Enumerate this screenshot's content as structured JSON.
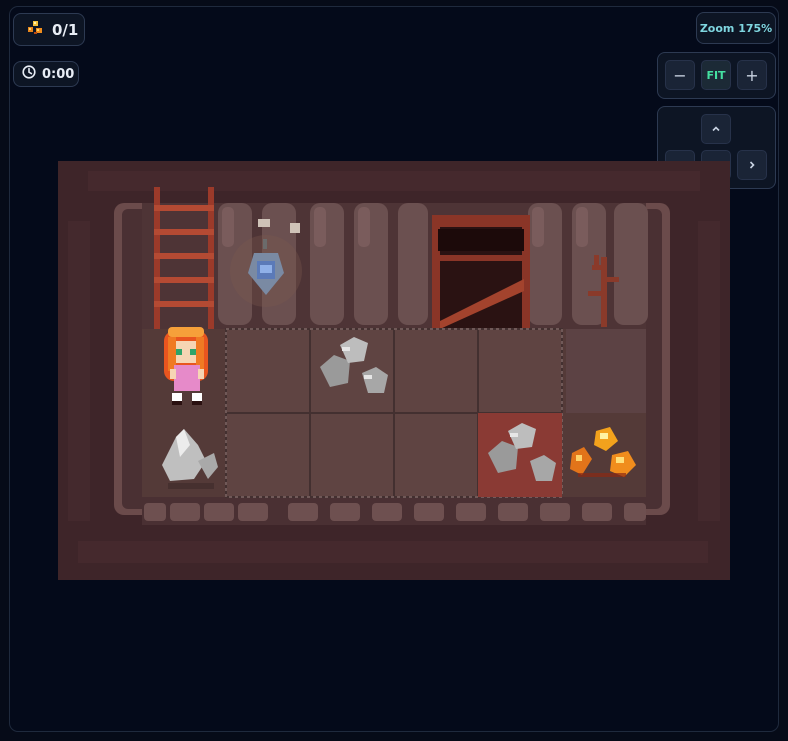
{
  "hud": {
    "ore_icon": "gold-ore-icon",
    "ore_counter": "0/1",
    "timer_icon": "clock-icon",
    "timer": "0:00",
    "zoom_label": "Zoom 175%"
  },
  "controls": {
    "zoom_out": "−",
    "fit": "FIT",
    "zoom_in": "+",
    "pan_up_icon": "chevron-up-icon",
    "pan_left_icon": "chevron-left-icon",
    "pan_down_icon": "chevron-down-icon",
    "pan_right_icon": "chevron-right-icon"
  },
  "scene": {
    "objects": [
      "ladder",
      "lantern",
      "mine-door",
      "dead-root",
      "player-miner",
      "stone-rocks",
      "crystal-rocks",
      "gold-ore"
    ],
    "colors": {
      "cave_bg": "#3e2529",
      "wall": "#5c4244",
      "floor": "#5a3f3d",
      "ladder": "#9b3a2a",
      "gold": "#f3a21c"
    }
  }
}
